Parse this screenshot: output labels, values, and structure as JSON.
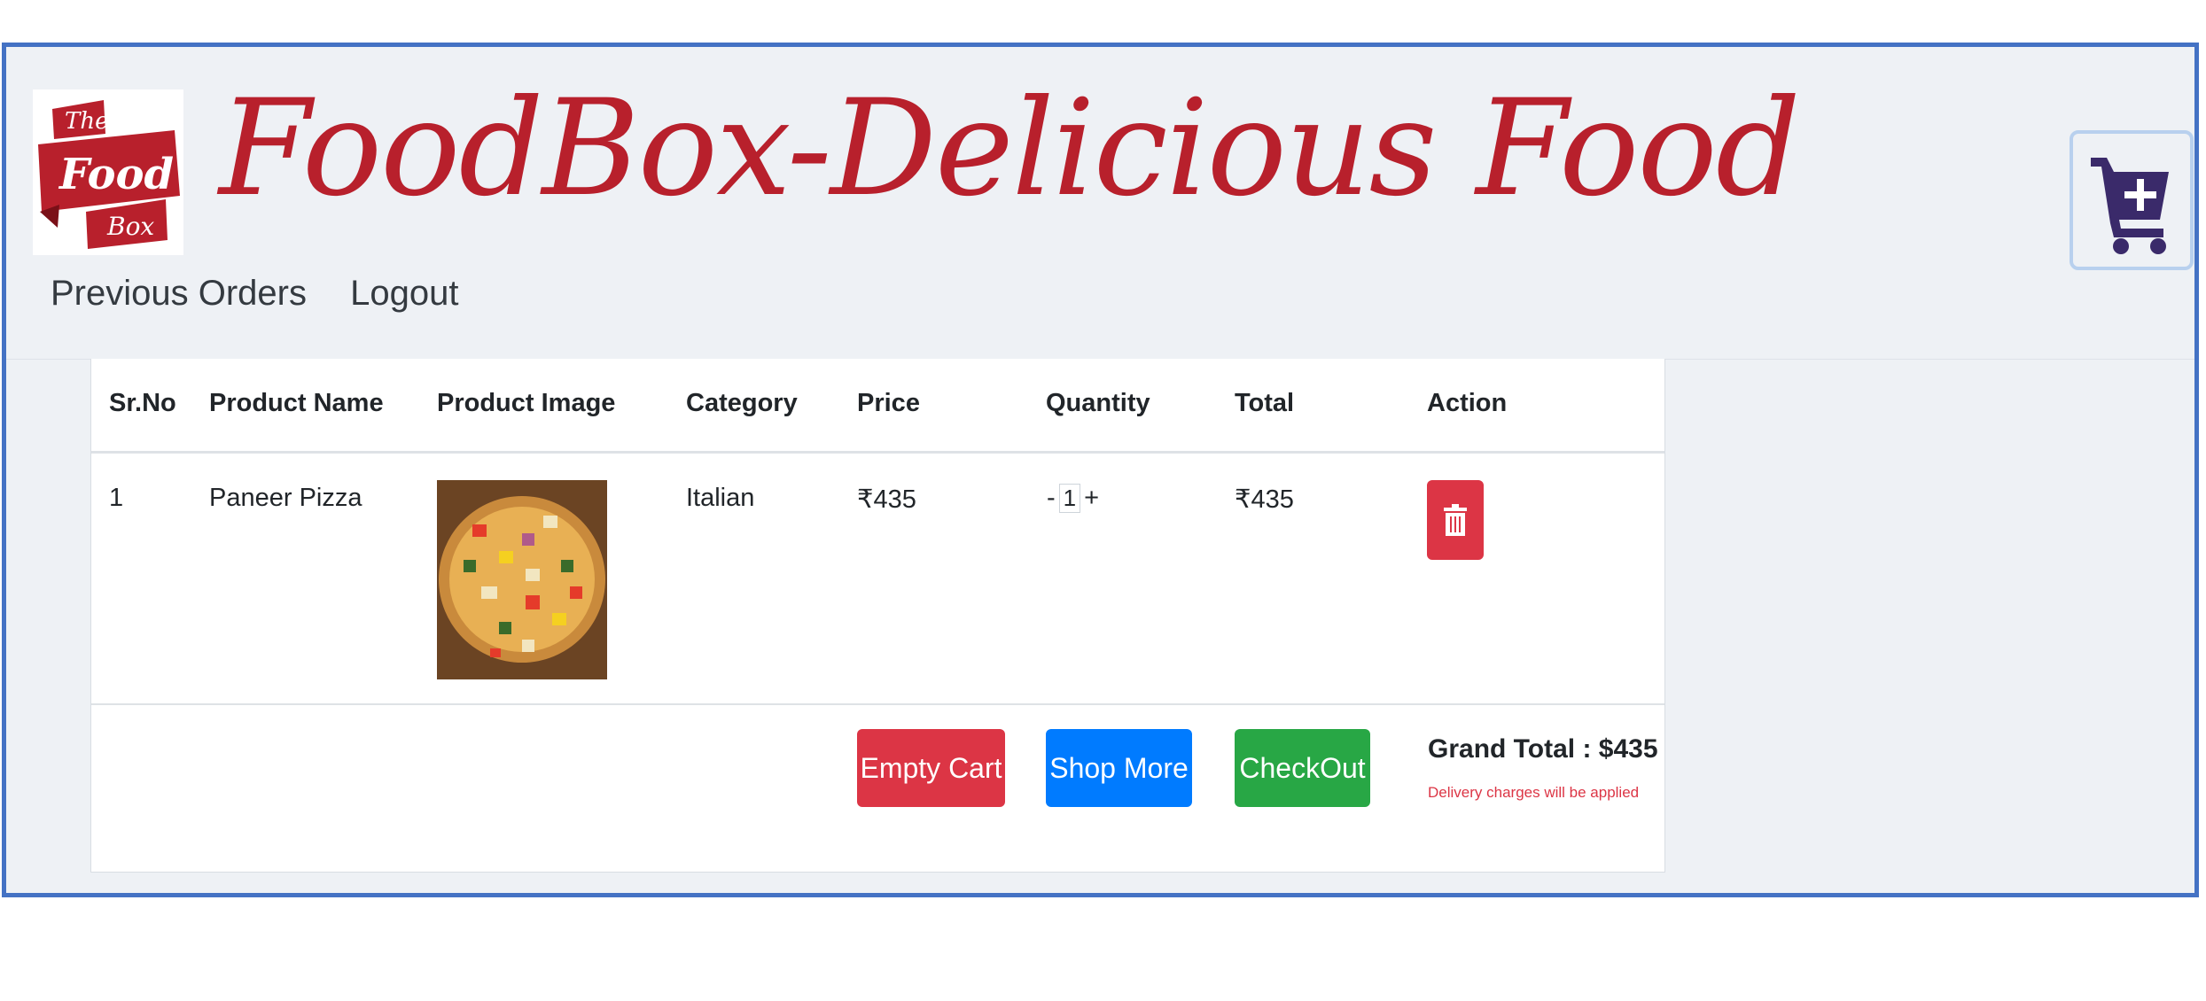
{
  "header": {
    "logo_text": [
      "The",
      "Food",
      "Box"
    ],
    "site_title": "FoodBox-Delicious Food",
    "nav": [
      {
        "label": "Previous Orders"
      },
      {
        "label": "Logout"
      }
    ],
    "cart_icon": "cart-plus-icon"
  },
  "cart_table": {
    "columns": [
      "Sr.No",
      "Product Name",
      "Product Image",
      "Category",
      "Price",
      "Quantity",
      "Total",
      "Action"
    ],
    "rows": [
      {
        "sr_no": "1",
        "product_name": "Paneer Pizza",
        "image": "pizza-image",
        "category": "Italian",
        "price": "₹435",
        "qty_minus": "-",
        "quantity": "1",
        "qty_plus": "+",
        "total": "₹435",
        "action_icon": "trash-icon"
      }
    ]
  },
  "footer": {
    "empty_cart_label": "Empty Cart",
    "shop_more_label": "Shop More",
    "checkout_label": "CheckOut",
    "grand_total": "Grand Total : $435",
    "delivery_note": "Delivery charges will be applied"
  },
  "colors": {
    "brand_red": "#b8202c",
    "danger": "#dc3545",
    "primary": "#007bff",
    "success": "#28a745",
    "frame_border": "#4472c4",
    "cart_icon": "#3a2a6a"
  }
}
